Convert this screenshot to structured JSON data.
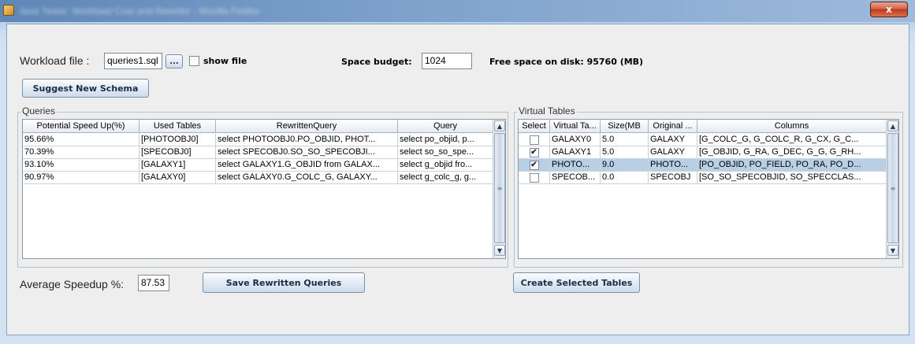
{
  "window": {
    "title": "Java Tester: Workload Cost and Rewriter - Mozilla Firefox",
    "close_glyph": "x"
  },
  "workload": {
    "label": "Workload file :",
    "file_value": "queries1.sql",
    "browse_label": "...",
    "show_file_label": "show file",
    "show_file_checked": false
  },
  "space": {
    "label": "Space budget:",
    "value": "1024",
    "free_space_text": "Free space on disk: 95760 (MB)"
  },
  "suggest_button": "Suggest New Schema",
  "queries": {
    "group_title": "Queries",
    "columns": [
      "Potential Speed Up(%)",
      "Used Tables",
      "RewrittenQuery",
      "Query"
    ],
    "rows": [
      [
        "95.66%",
        "[PHOTOOBJ0]",
        "select PHOTOOBJ0.PO_OBJID, PHOT...",
        "select po_objid, p..."
      ],
      [
        "70.39%",
        "[SPECOBJ0]",
        "select SPECOBJ0.SO_SO_SPECOBJI...",
        "select so_so_spe..."
      ],
      [
        "93.10%",
        "[GALAXY1]",
        "select GALAXY1.G_OBJID from GALAX...",
        "select g_objid fro..."
      ],
      [
        "90.97%",
        "[GALAXY0]",
        "select GALAXY0.G_COLC_G, GALAXY...",
        "select g_colc_g, g..."
      ]
    ]
  },
  "virtual_tables": {
    "group_title": "Virtual Tables",
    "columns": [
      "Select",
      "Virtual Ta...",
      "Size(MB",
      "Original ...",
      "Columns"
    ],
    "rows": [
      {
        "checked": false,
        "name": "GALAXY0",
        "size": "5.0",
        "original": "GALAXY",
        "columns": "[G_COLC_G, G_COLC_R, G_CX, G_C...",
        "selected": false
      },
      {
        "checked": true,
        "name": "GALAXY1",
        "size": "5.0",
        "original": "GALAXY",
        "columns": "[G_OBJID, G_RA, G_DEC, G_G, G_RH...",
        "selected": false
      },
      {
        "checked": true,
        "name": "PHOTO...",
        "size": "9.0",
        "original": "PHOTO...",
        "columns": "[PO_OBJID, PO_FIELD, PO_RA, PO_D...",
        "selected": true
      },
      {
        "checked": false,
        "name": "SPECOB...",
        "size": "0.0",
        "original": "SPECOBJ",
        "columns": "[SO_SO_SPECOBJID, SO_SPECCLAS...",
        "selected": false
      }
    ]
  },
  "speedup": {
    "label": "Average Speedup %:",
    "value": "87.53"
  },
  "save_button": "Save Rewritten Queries",
  "create_button": "Create Selected Tables",
  "colors": {
    "selection": "#b8cfe5",
    "button_text": "#1d2c45"
  },
  "icons": {
    "scroll_up": "▲",
    "scroll_down": "▼",
    "thumb_grip": "≡",
    "check": "✔"
  }
}
